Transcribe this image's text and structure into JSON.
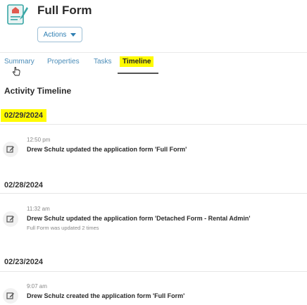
{
  "header": {
    "title": "Full Form",
    "actions_label": "Actions"
  },
  "tabs": [
    {
      "label": "Summary"
    },
    {
      "label": "Properties"
    },
    {
      "label": "Tasks"
    },
    {
      "label": "Timeline",
      "active": true
    }
  ],
  "section_title": "Activity Timeline",
  "colors": {
    "highlight": "#fffb00",
    "accent": "#2f7fb3",
    "icon_red": "#e05a4f",
    "icon_teal": "#3aa7a6"
  },
  "timeline": [
    {
      "date": "02/29/2024",
      "time": "12:50 pm",
      "description": "Drew Schulz updated the application form 'Full Form'",
      "note": ""
    },
    {
      "date": "02/28/2024",
      "time": "11:32 am",
      "description": "Drew Schulz updated the application form 'Detached Form - Rental Admin'",
      "note": "Full Form was updated 2 times"
    },
    {
      "date": "02/23/2024",
      "time": "9:07 am",
      "description": "Drew Schulz created the application form 'Full Form'",
      "note": ""
    }
  ]
}
